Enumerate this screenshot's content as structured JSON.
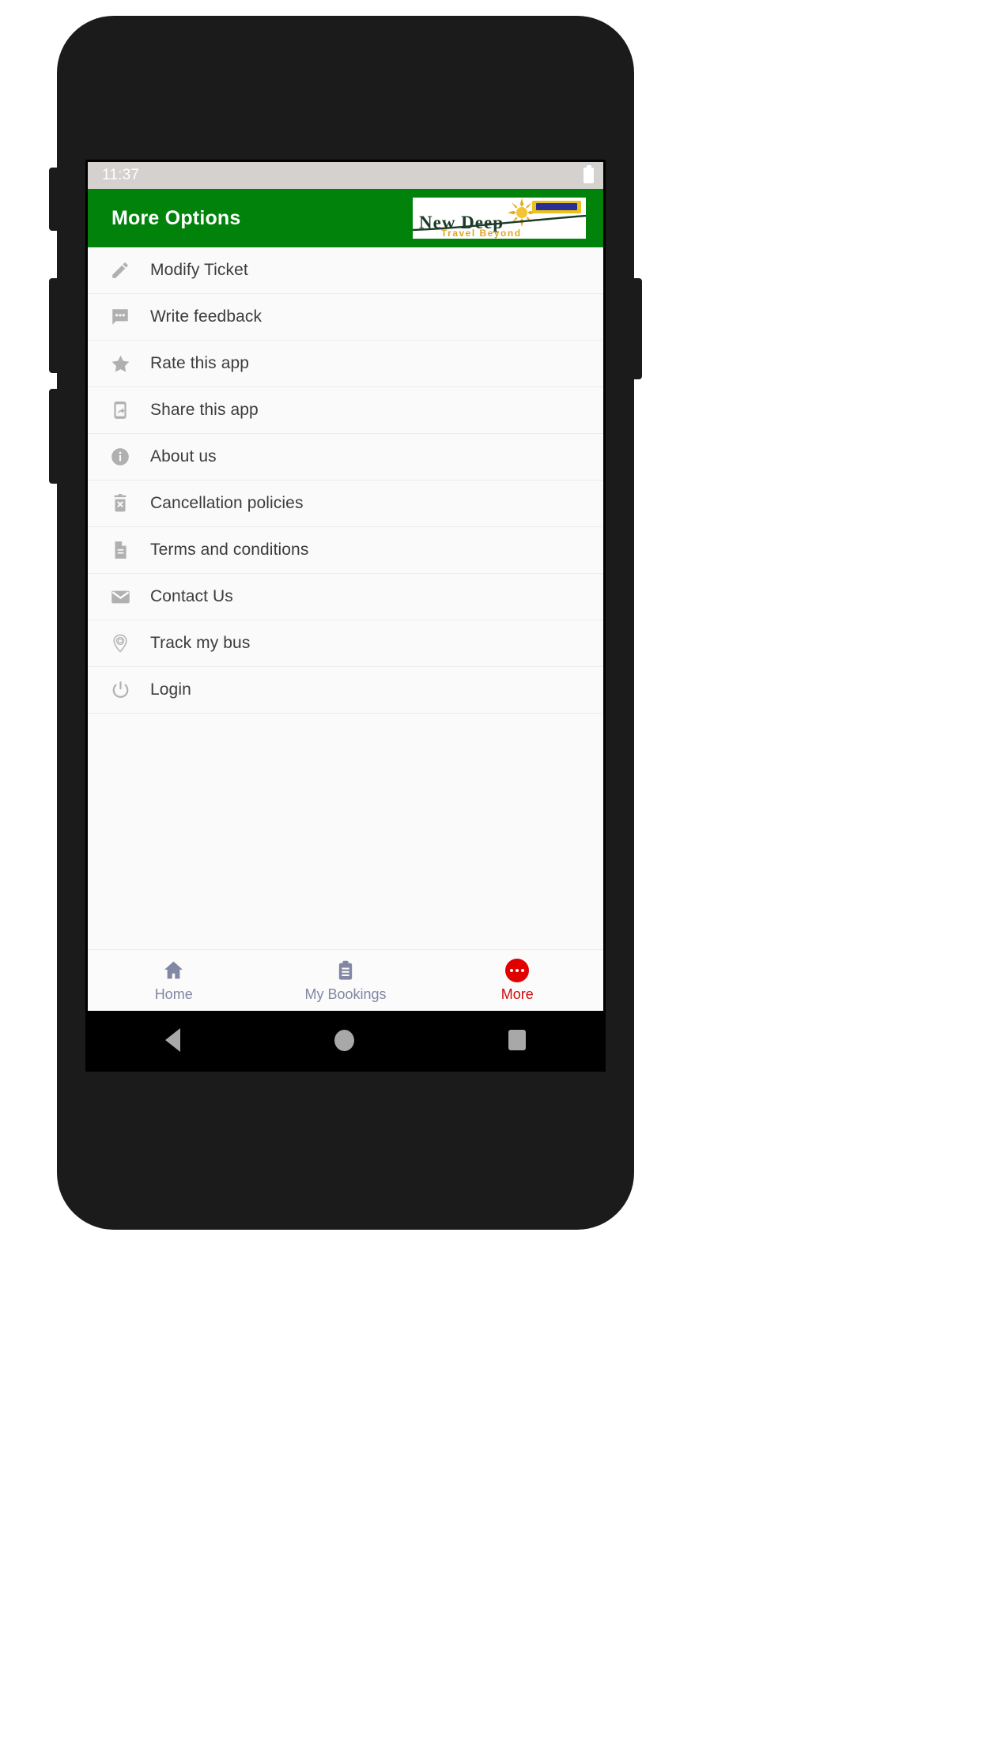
{
  "status_bar": {
    "time": "11:37",
    "battery_icon": "battery-icon"
  },
  "app_bar": {
    "title": "More Options",
    "logo": {
      "name": "New Deep",
      "tagline": "Travel Beyond",
      "sun_icon": "sun-icon",
      "bus_icon": "bus-icon",
      "background": "#ffffff",
      "name_color": "#1d3b28",
      "tagline_color": "#e0a526"
    },
    "background": "#00820b",
    "title_color": "#ffffff"
  },
  "options": [
    {
      "label": "Modify Ticket",
      "icon": "pencil-icon"
    },
    {
      "label": "Write feedback",
      "icon": "chat-bubble-icon"
    },
    {
      "label": "Rate this app",
      "icon": "star-icon"
    },
    {
      "label": "Share this app",
      "icon": "phone-share-icon"
    },
    {
      "label": "About us",
      "icon": "info-circle-icon"
    },
    {
      "label": "Cancellation policies",
      "icon": "trash-x-icon"
    },
    {
      "label": "Terms and conditions",
      "icon": "document-icon"
    },
    {
      "label": "Contact Us",
      "icon": "envelope-icon"
    },
    {
      "label": "Track my bus",
      "icon": "map-pin-bus-icon"
    },
    {
      "label": "Login",
      "icon": "power-icon"
    }
  ],
  "bottom_nav": {
    "items": [
      {
        "label": "Home",
        "icon": "home-icon",
        "active": false
      },
      {
        "label": "My Bookings",
        "icon": "clipboard-icon",
        "active": false
      },
      {
        "label": "More",
        "icon": "ellipsis-icon",
        "active": true
      }
    ],
    "active_color": "#d10b0b",
    "inactive_color": "#8287a3"
  },
  "android_nav": {
    "back": "back-triangle-icon",
    "home": "home-circle-icon",
    "recents": "recents-square-icon"
  },
  "colors": {
    "brand_green": "#00820b",
    "accent_red": "#e00000",
    "icon_gray": "#b0b0b0",
    "text_dark": "#3c3c3c"
  }
}
